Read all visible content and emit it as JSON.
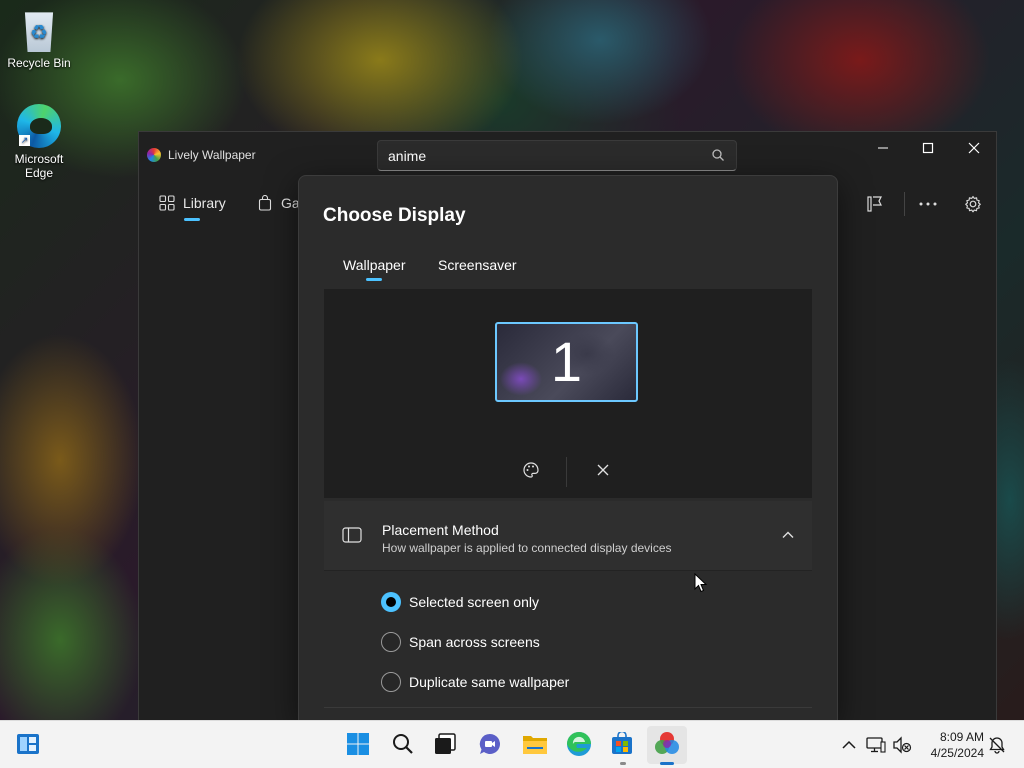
{
  "desktop": {
    "icons": [
      {
        "label": "Recycle Bin",
        "icon": "recycle-bin-icon"
      },
      {
        "label": "Microsoft\nEdge",
        "icon": "edge-icon"
      }
    ]
  },
  "window": {
    "title": "Lively Wallpaper",
    "search": {
      "value": "anime",
      "placeholder": "Search"
    },
    "nav": {
      "library": "Library",
      "gallery": "Gal"
    },
    "toolbar_icons": [
      "customize-icon",
      "more-icon",
      "settings-icon"
    ]
  },
  "dialog": {
    "title": "Choose Display",
    "tabs": [
      "Wallpaper",
      "Screensaver"
    ],
    "selected_tab": "Wallpaper",
    "display": {
      "number": "1"
    },
    "placement": {
      "title": "Placement Method",
      "description": "How wallpaper is applied to connected display devices",
      "options": [
        "Selected screen only",
        "Span across screens",
        "Duplicate same wallpaper"
      ],
      "selected": "Selected screen only"
    }
  },
  "taskbar": {
    "time": "8:09 AM",
    "date": "4/25/2024",
    "colors": {
      "accent": "#4cc2ff",
      "running": "#1a73c9"
    }
  }
}
